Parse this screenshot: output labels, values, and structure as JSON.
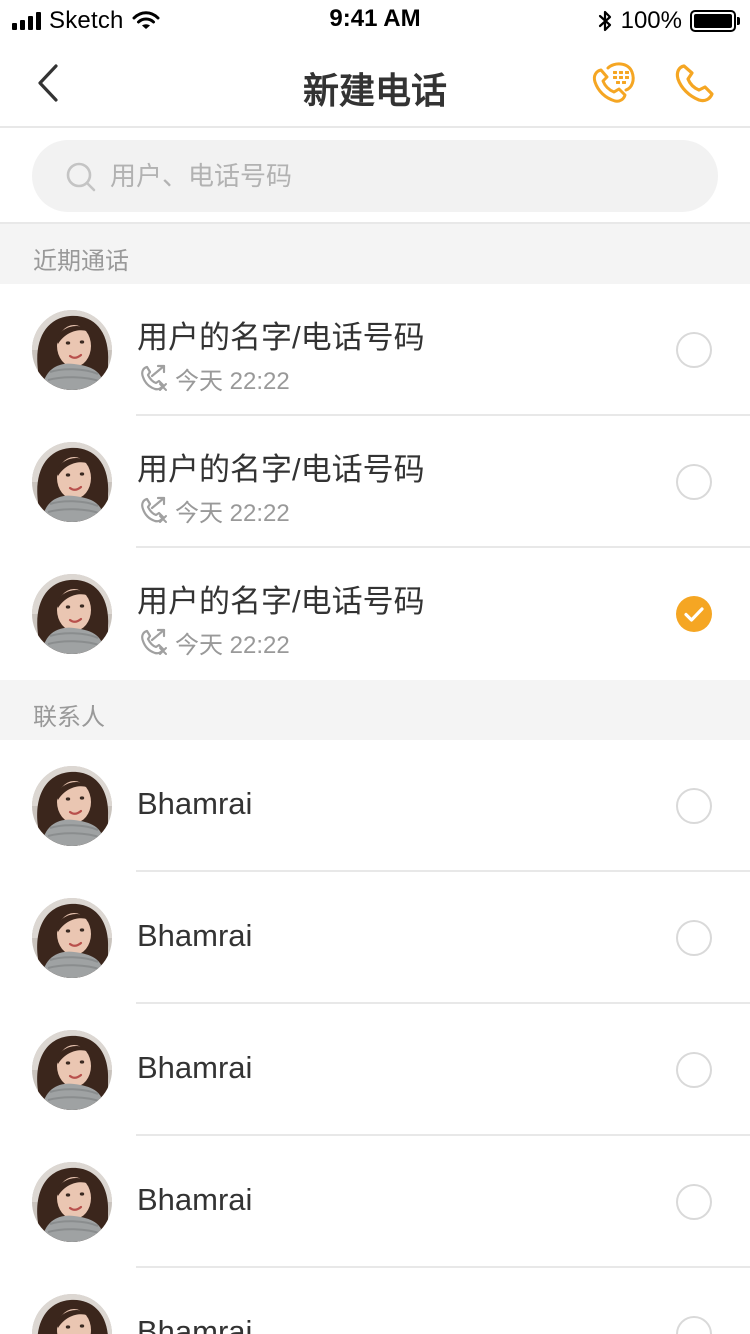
{
  "status_bar": {
    "carrier": "Sketch",
    "time": "9:41 AM",
    "battery": "100%"
  },
  "nav": {
    "title": "新建电话",
    "back_icon": "chevron-left-icon",
    "dialpad_icon": "dialpad-phone-icon",
    "call_icon": "phone-icon"
  },
  "search": {
    "placeholder": "用户、电话号码",
    "value": ""
  },
  "colors": {
    "accent": "#f5a623",
    "muted_text": "#999999",
    "divider": "#e8e8e8",
    "section_bg": "#f4f4f4"
  },
  "recent": {
    "header": "近期通话",
    "items": [
      {
        "title": "用户的名字/电话号码",
        "time": "今天 22:22",
        "selected": false
      },
      {
        "title": "用户的名字/电话号码",
        "time": "今天 22:22",
        "selected": false
      },
      {
        "title": "用户的名字/电话号码",
        "time": "今天 22:22",
        "selected": true
      }
    ]
  },
  "contacts": {
    "header": "联系人",
    "items": [
      {
        "name": "Bhamrai",
        "selected": false
      },
      {
        "name": "Bhamrai",
        "selected": false
      },
      {
        "name": "Bhamrai",
        "selected": false
      },
      {
        "name": "Bhamrai",
        "selected": false
      },
      {
        "name": "Bhamrai",
        "selected": false
      }
    ]
  }
}
